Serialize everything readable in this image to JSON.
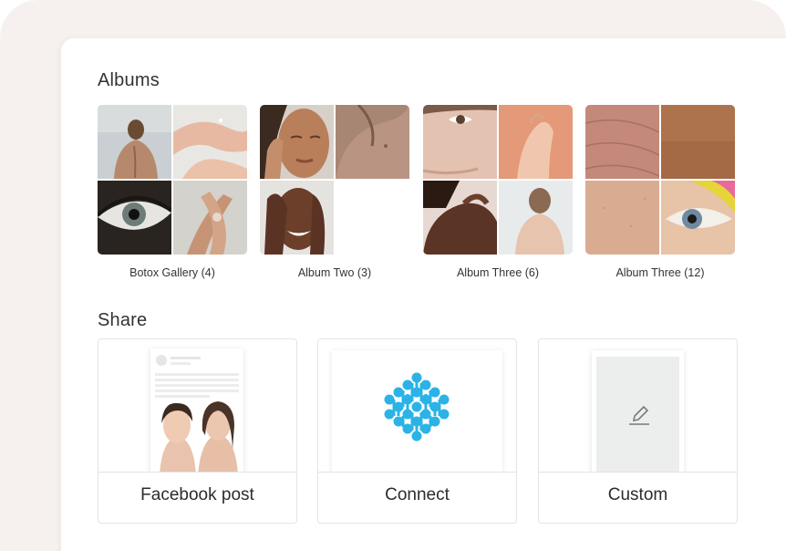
{
  "albums": {
    "title": "Albums",
    "items": [
      {
        "caption": "Botox Gallery (4)"
      },
      {
        "caption": "Album Two (3)"
      },
      {
        "caption": "Album Three (6)"
      },
      {
        "caption": "Album Three (12)"
      }
    ]
  },
  "share": {
    "title": "Share",
    "options": [
      {
        "label": "Facebook post"
      },
      {
        "label": "Connect"
      },
      {
        "label": "Custom"
      }
    ]
  },
  "icons": {
    "connect": "connect-logo-icon",
    "custom": "pencil-edit-icon"
  },
  "colors": {
    "accent": "#2bb3e6",
    "background": "#f6f1ee"
  }
}
